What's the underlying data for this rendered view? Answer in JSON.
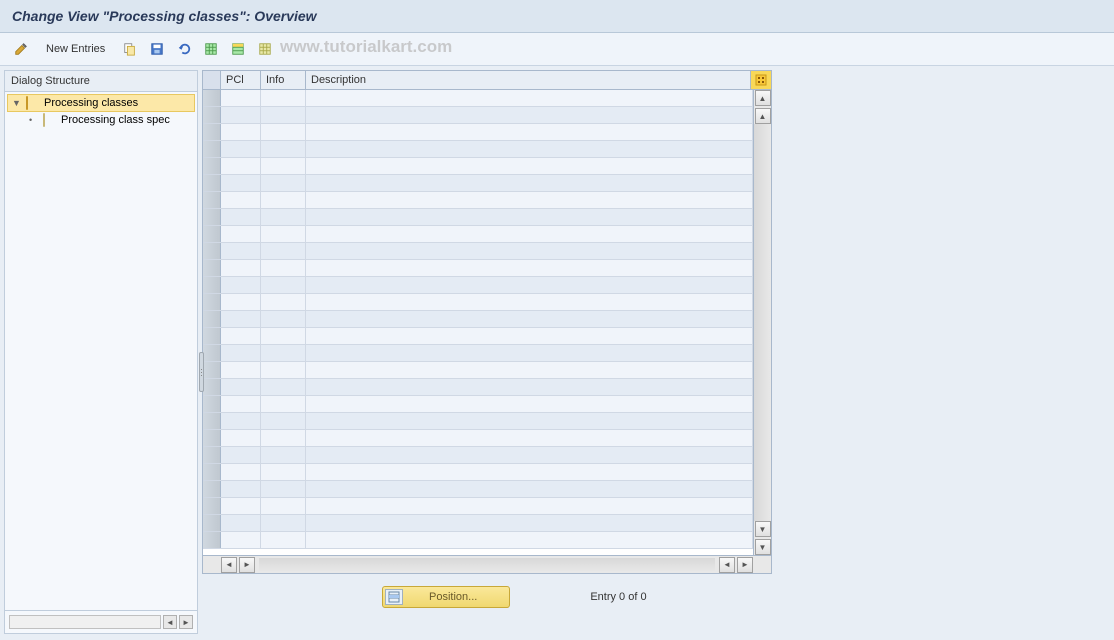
{
  "title": "Change View \"Processing classes\": Overview",
  "watermark": "www.tutorialkart.com",
  "toolbar": {
    "new_entries_label": "New Entries"
  },
  "sidebar": {
    "header": "Dialog Structure",
    "items": [
      {
        "label": "Processing classes",
        "selected": true,
        "expanded": true,
        "level": 0
      },
      {
        "label": "Processing class spec",
        "selected": false,
        "expanded": false,
        "level": 1
      }
    ]
  },
  "table": {
    "columns": [
      {
        "key": "pcl",
        "label": "PCl"
      },
      {
        "key": "info",
        "label": "Info"
      },
      {
        "key": "desc",
        "label": "Description"
      }
    ],
    "row_count": 27
  },
  "footer": {
    "position_label": "Position...",
    "entry_status": "Entry 0 of 0"
  },
  "icons": {
    "pencil": "pencil-icon",
    "copy": "copy-icon",
    "save": "save-icon",
    "undo": "undo-icon",
    "spreadsheet1": "spreadsheet-icon",
    "spreadsheet2": "spreadsheet-select-icon",
    "spreadsheet3": "spreadsheet-delim-icon",
    "config": "config-icon"
  }
}
